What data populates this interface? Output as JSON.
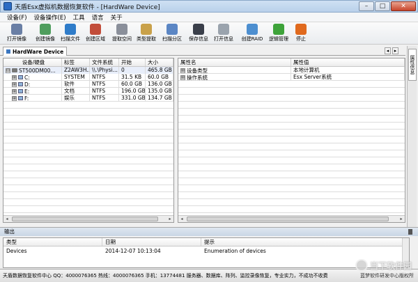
{
  "window": {
    "title": "天盾Esx虚拟机数据恢复软件 - [HardWare Device]",
    "minimize": "–",
    "maximize": "□",
    "close": "✕"
  },
  "menu": [
    "设备(F)",
    "设备操作(E)",
    "工具",
    "语言",
    "关于"
  ],
  "toolbar": [
    {
      "label": "打开镜像",
      "icon": "open-image-icon",
      "color": "#6a7fa5"
    },
    {
      "label": "创建镜像",
      "icon": "create-image-icon",
      "color": "#4f9d5d"
    },
    {
      "label": "扫描文件",
      "icon": "scan-file-icon",
      "color": "#2f7cc9"
    },
    {
      "label": "创建区域",
      "icon": "create-region-icon",
      "color": "#c24d3a"
    },
    {
      "label": "提取空间",
      "icon": "extract-space-icon",
      "color": "#8a8f9a"
    },
    {
      "label": "类型提取",
      "icon": "type-extract-icon",
      "color": "#c9a14a"
    },
    {
      "label": "扫描分区",
      "icon": "scan-partition-icon",
      "color": "#5b86c4"
    },
    {
      "label": "保存信息",
      "icon": "save-info-icon",
      "color": "#3a3f4a"
    },
    {
      "label": "打开信息",
      "icon": "open-info-icon",
      "color": "#9aa3ad"
    },
    {
      "label": "创建RAID",
      "icon": "create-raid-icon",
      "color": "#4d8fd0"
    },
    {
      "label": "逻辑管理",
      "icon": "logic-manage-icon",
      "color": "#3ea33a"
    },
    {
      "label": "停止",
      "icon": "stop-icon",
      "color": "#e06a1e"
    }
  ],
  "tab": {
    "label": "HardWare Device",
    "prev": "◂",
    "next": "▸"
  },
  "side_tab": "属性信息",
  "device_table": {
    "columns": [
      "设备/硬盘",
      "标签",
      "文件系统",
      "开始",
      "大小"
    ],
    "rows": [
      {
        "expand": "⊟",
        "name": "ST500DM00...",
        "label": "Z2AW3H...",
        "fs": "\\\\.\\Physi...",
        "start": "0",
        "size": "465.8 GB",
        "kind": "disk"
      },
      {
        "expand": "⊞",
        "name": "C:",
        "label": "SYSTEM",
        "fs": "NTFS",
        "start": "31.5 KB",
        "size": "60.0 GB",
        "kind": "volume"
      },
      {
        "expand": "⊞",
        "name": "D:",
        "label": "软件",
        "fs": "NTFS",
        "start": "60.0 GB",
        "size": "136.0 GB",
        "kind": "volume"
      },
      {
        "expand": "⊞",
        "name": "E:",
        "label": "文档",
        "fs": "NTFS",
        "start": "196.0 GB",
        "size": "135.0 GB",
        "kind": "volume"
      },
      {
        "expand": "⊞",
        "name": "F:",
        "label": "娱乐",
        "fs": "NTFS",
        "start": "331.0 GB",
        "size": "134.7 GB",
        "kind": "volume"
      }
    ]
  },
  "property_table": {
    "columns": [
      "属性名",
      "属性值"
    ],
    "rows": [
      {
        "expand": "⊞",
        "name": "设备类型",
        "value": "本地计算机"
      },
      {
        "expand": "⊞",
        "name": "操作系统",
        "value": "Esx Server系统"
      }
    ]
  },
  "output": {
    "title": "输出",
    "columns": [
      "类型",
      "日期",
      "提示"
    ],
    "rows": [
      {
        "type": "Devices",
        "date": "2014-12-07 10:13:04",
        "hint": "Enumeration of devices"
      }
    ]
  },
  "status": {
    "text": "天盾数据恢复软件中心 QQ：4000076365 热线：4000076365 手机：13774481   服务器、数据库、阵列、监控录像恢复，专业实力，不成功不收费",
    "right": "蓝梦软件研发中心版权所"
  },
  "watermark": "当下软件园",
  "scroll": {
    "left": "◂",
    "right": "▸"
  }
}
